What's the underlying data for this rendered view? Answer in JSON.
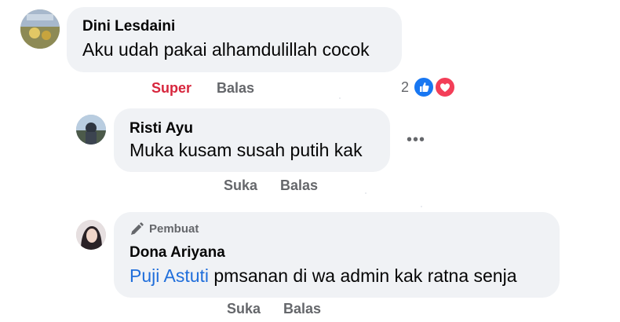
{
  "comments": [
    {
      "author": "Dini Lesdaini",
      "text": "Aku udah pakai alhamdulillah cocok",
      "actions": {
        "reaction": "Super",
        "reply": "Balas"
      },
      "reaction_count": "2",
      "reaction_icons": [
        "like-icon",
        "love-icon"
      ]
    },
    {
      "author": "Risti Ayu",
      "text": "Muka kusam susah putih kak",
      "actions": {
        "like": "Suka",
        "reply": "Balas"
      },
      "more": "•••"
    },
    {
      "badge": "Pembuat",
      "author": "Dona Ariyana",
      "mention": "Puji Astuti",
      "text": "pmsanan di wa admin kak ratna senja",
      "actions": {
        "like": "Suka",
        "reply": "Balas"
      }
    }
  ],
  "colors": {
    "bubble": "#f0f2f5",
    "action_text": "#65676b",
    "super_reaction": "#d7263d",
    "mention": "#216fdb",
    "like_blue": "#1877f2",
    "love_red": "#f33e58"
  }
}
